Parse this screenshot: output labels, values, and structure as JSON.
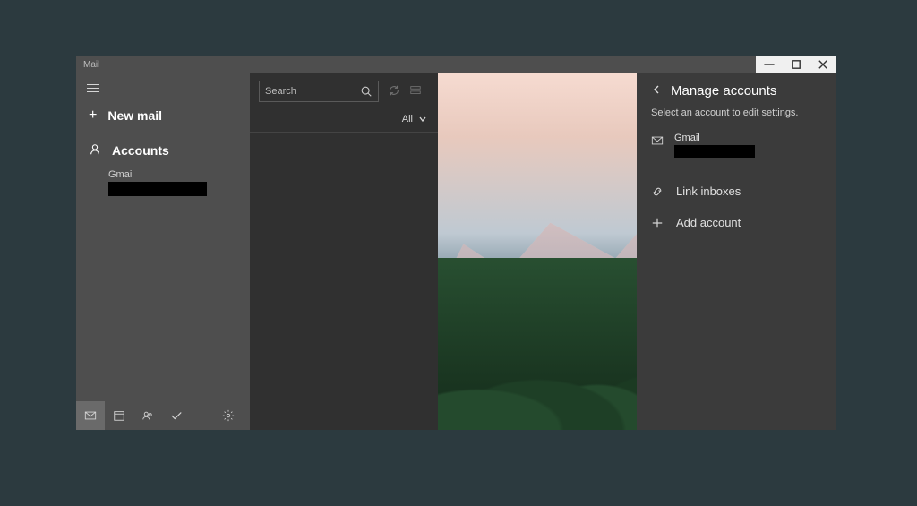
{
  "titlebar": {
    "title": "Mail"
  },
  "nav": {
    "newMail": "New mail",
    "accountsHeader": "Accounts",
    "accountName": "Gmail"
  },
  "search": {
    "placeholder": "Search"
  },
  "filter": {
    "label": "All"
  },
  "flyout": {
    "title": "Manage accounts",
    "subtitle": "Select an account to edit settings.",
    "accountName": "Gmail",
    "linkInboxes": "Link inboxes",
    "addAccount": "Add account"
  }
}
